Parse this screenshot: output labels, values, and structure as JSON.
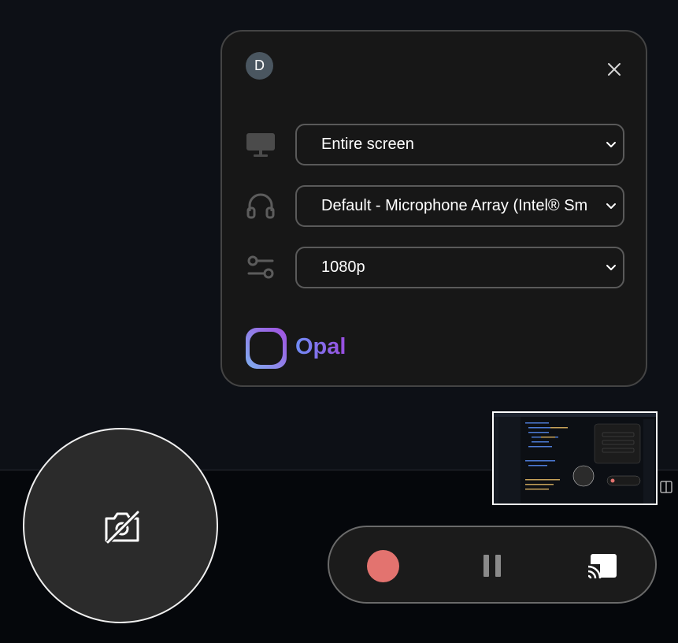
{
  "panel": {
    "avatar_initial": "D",
    "screen_select": {
      "value": "Entire screen",
      "icon": "monitor-icon"
    },
    "audio_select": {
      "value": "Default - Microphone Array (Intel® Smart Sound Technology)",
      "icon": "headphones-icon"
    },
    "quality_select": {
      "value": "1080p",
      "icon": "sliders-icon"
    },
    "brand": {
      "name": "Opal",
      "gradient_start": "#6f8df5",
      "gradient_end": "#9a4de0"
    }
  },
  "camera": {
    "icon": "camera-off-icon"
  },
  "controls": {
    "record_color": "#e3736f",
    "record_icon": "record-icon",
    "pause_icon": "pause-icon",
    "cast_icon": "cast-icon"
  }
}
